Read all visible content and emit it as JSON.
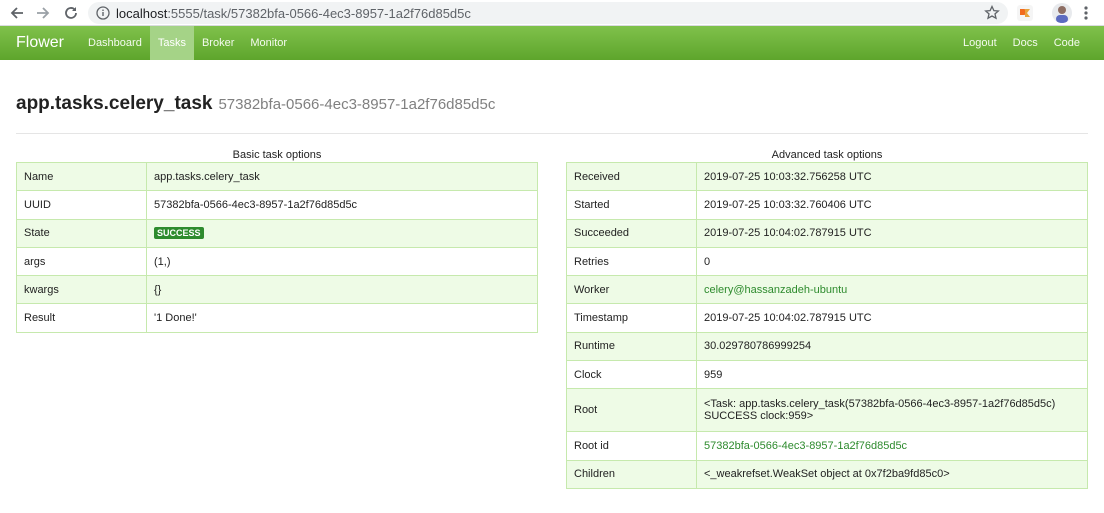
{
  "browser": {
    "url_host": "localhost",
    "url_rest": ":5555/task/57382bfa-0566-4ec3-8957-1a2f76d85d5c"
  },
  "navbar": {
    "brand": "Flower",
    "items": [
      "Dashboard",
      "Tasks",
      "Broker",
      "Monitor"
    ],
    "active": "Tasks",
    "right_items": [
      "Logout",
      "Docs",
      "Code"
    ]
  },
  "header": {
    "task_name": "app.tasks.celery_task",
    "task_id": "57382bfa-0566-4ec3-8957-1a2f76d85d5c"
  },
  "basic": {
    "caption": "Basic task options",
    "rows": [
      {
        "key": "Name",
        "value": "app.tasks.celery_task"
      },
      {
        "key": "UUID",
        "value": "57382bfa-0566-4ec3-8957-1a2f76d85d5c"
      },
      {
        "key": "State",
        "value": "SUCCESS"
      },
      {
        "key": "args",
        "value": "(1,)"
      },
      {
        "key": "kwargs",
        "value": "{}"
      },
      {
        "key": "Result",
        "value": "'1 Done!'"
      }
    ]
  },
  "advanced": {
    "caption": "Advanced task options",
    "rows": [
      {
        "key": "Received",
        "value": "2019-07-25 10:03:32.756258 UTC"
      },
      {
        "key": "Started",
        "value": "2019-07-25 10:03:32.760406 UTC"
      },
      {
        "key": "Succeeded",
        "value": "2019-07-25 10:04:02.787915 UTC"
      },
      {
        "key": "Retries",
        "value": "0"
      },
      {
        "key": "Worker",
        "value": "celery@hassanzadeh-ubuntu"
      },
      {
        "key": "Timestamp",
        "value": "2019-07-25 10:04:02.787915 UTC"
      },
      {
        "key": "Runtime",
        "value": "30.029780786999254"
      },
      {
        "key": "Clock",
        "value": "959"
      },
      {
        "key": "Root",
        "value_line1": "<Task: app.tasks.celery_task(57382bfa-0566-4ec3-8957-1a2f76d85d5c)",
        "value_line2": "SUCCESS clock:959>"
      },
      {
        "key": "Root id",
        "value": "57382bfa-0566-4ec3-8957-1a2f76d85d5c"
      },
      {
        "key": "Children",
        "value": "<_weakrefset.WeakSet object at 0x7f2ba9fd85c0>"
      }
    ]
  },
  "colors": {
    "navbar_top": "#80c14b",
    "navbar_bottom": "#5ea52c",
    "success_badge": "#2e8b2e",
    "link": "#2e8b2e",
    "row_stripe": "#eefbe6",
    "table_border": "#c6e9ad"
  }
}
